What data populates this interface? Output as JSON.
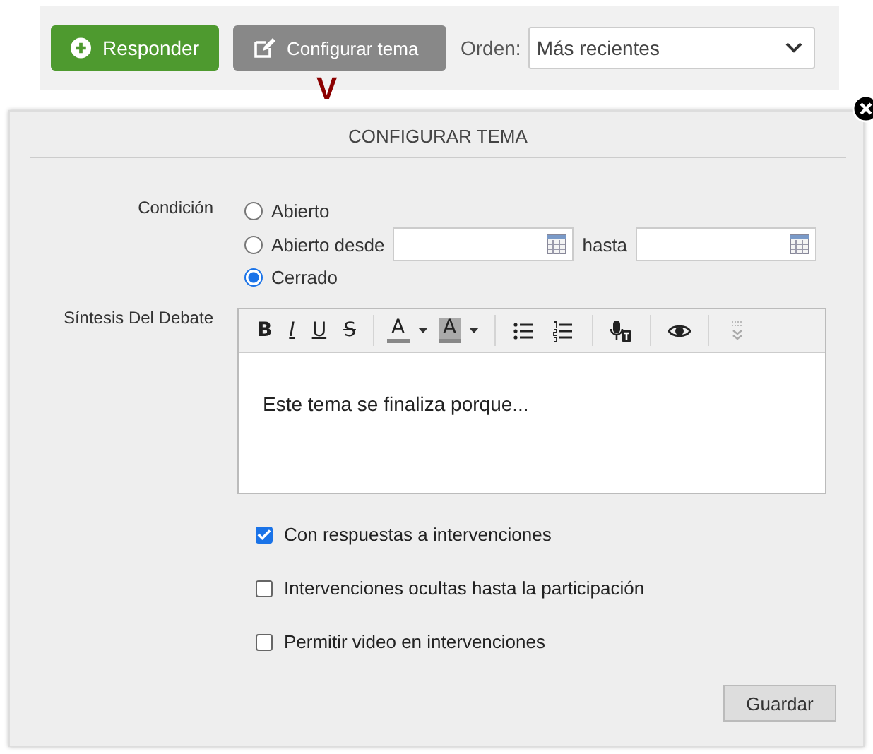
{
  "topbar": {
    "buttons": [
      {
        "label": "Responder",
        "kind": "primary"
      },
      {
        "label": "Configurar tema",
        "kind": "secondary"
      }
    ],
    "order": {
      "label": "Orden:",
      "value": "Más recientes"
    },
    "pointer": "V"
  },
  "panel": {
    "title": "CONFIGURAR TEMA",
    "condition": {
      "label": "Condición",
      "options": [
        {
          "label": "Abierto",
          "selected": false,
          "kind": "plain"
        },
        {
          "label": "Abierto desde",
          "selected": false,
          "kind": "range",
          "between": "hasta"
        },
        {
          "label": "Cerrado",
          "selected": true,
          "kind": "plain"
        }
      ]
    },
    "summary": {
      "label": "Síntesis Del Debate",
      "toolbar": [
        {
          "kind": "bold",
          "text": "B"
        },
        {
          "kind": "italic",
          "text": "I"
        },
        {
          "kind": "underline",
          "text": "U"
        },
        {
          "kind": "strike",
          "text": "S"
        },
        {
          "kind": "sep"
        },
        {
          "kind": "color",
          "text": "A"
        },
        {
          "kind": "bgcolor",
          "text": "A"
        },
        {
          "kind": "sep"
        },
        {
          "kind": "bullets"
        },
        {
          "kind": "numbers"
        },
        {
          "kind": "sep"
        },
        {
          "kind": "speech"
        },
        {
          "kind": "sep"
        },
        {
          "kind": "preview"
        },
        {
          "kind": "sep"
        },
        {
          "kind": "more"
        }
      ],
      "content": "Este tema se finaliza porque..."
    },
    "options": [
      {
        "label": "Con respuestas a intervenciones",
        "checked": true
      },
      {
        "label": "Intervenciones ocultas hasta la participación",
        "checked": false
      },
      {
        "label": "Permitir video en intervenciones",
        "checked": false
      }
    ],
    "save": "Guardar"
  }
}
